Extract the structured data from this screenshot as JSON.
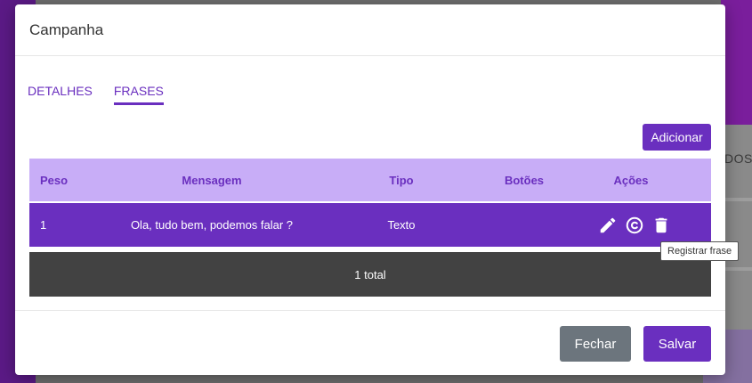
{
  "background": {
    "partial_text": "DOS"
  },
  "modal": {
    "title": "Campanha",
    "tabs": [
      {
        "label": "DETALHES",
        "active": false
      },
      {
        "label": "FRASES",
        "active": true
      }
    ],
    "add_label": "Adicionar",
    "table": {
      "headers": [
        "Peso",
        "Mensagem",
        "Tipo",
        "Botões",
        "Ações"
      ],
      "rows": [
        {
          "peso": "1",
          "mensagem": "Ola, tudo bem, podemos falar ?",
          "tipo": "Texto",
          "botoes": ""
        }
      ],
      "total": "1 total"
    },
    "tooltip": "Registrar frase",
    "footer": {
      "close_label": "Fechar",
      "save_label": "Salvar"
    }
  },
  "colors": {
    "primary": "#6a2fbf",
    "header_bg": "#c8adf7",
    "total_bg": "#424242",
    "close_btn": "#6c757d"
  },
  "icons": {
    "edit": "pencil-icon",
    "register": "copyright-icon",
    "delete": "trash-icon"
  }
}
